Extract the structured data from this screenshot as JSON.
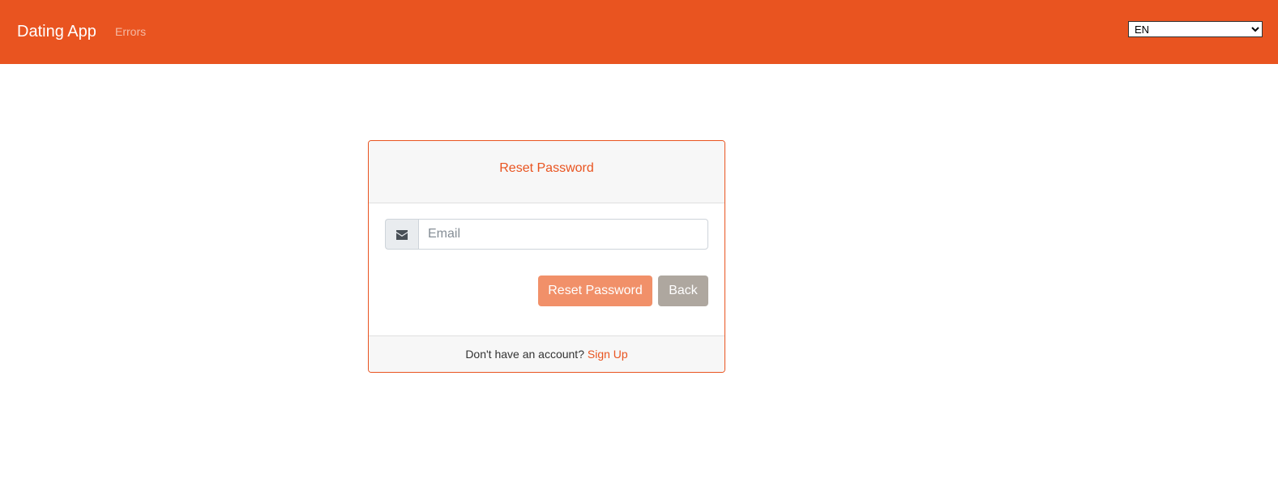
{
  "navbar": {
    "brand": "Dating App",
    "links": [
      "Errors"
    ],
    "language": {
      "selected": "EN"
    },
    "background_color": "#e95420"
  },
  "card": {
    "title": "Reset Password",
    "email_field": {
      "placeholder": "Email",
      "value": "",
      "icon": "envelope-icon"
    },
    "buttons": {
      "reset_label": "Reset Password",
      "back_label": "Back"
    },
    "footer": {
      "prompt": "Don't have an account?",
      "link_label": "Sign Up"
    },
    "accent_color": "#e95420",
    "reset_button_color": "#f19069",
    "back_button_color": "#aea79f"
  }
}
